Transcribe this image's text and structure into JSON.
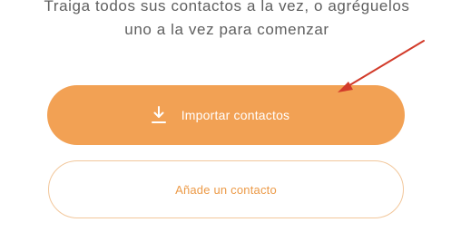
{
  "intro": {
    "line1": "Traiga todos sus contactos a la vez, o agréguelos",
    "line2": "uno a la vez para comenzar"
  },
  "buttons": {
    "import_label": "Importar contactos",
    "import_icon": "download-icon",
    "add_label": "Añade un contacto"
  },
  "annotation": {
    "type": "arrow",
    "icon": "red-arrow-annotation",
    "color": "#d23b2a"
  },
  "colors": {
    "accent": "#f2a154",
    "accent_text": "#ec9a47",
    "outline": "#f2c79b",
    "body_text": "#5f5f5f"
  }
}
